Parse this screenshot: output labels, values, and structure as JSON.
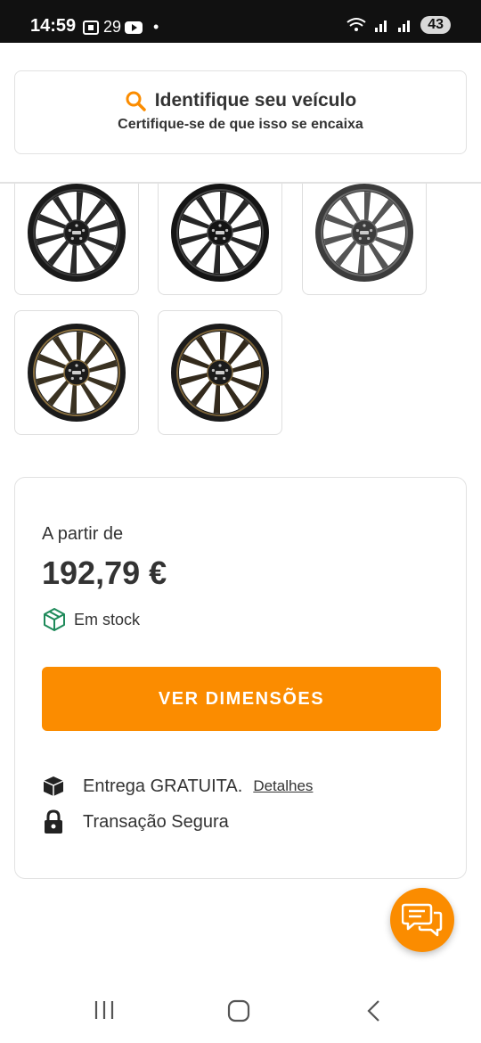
{
  "status_bar": {
    "time": "14:59",
    "temperature": "29",
    "battery": "43"
  },
  "vehicle": {
    "title": "Identifique seu veículo",
    "subtitle": "Certifique-se de que isso se encaixa"
  },
  "gallery": {
    "items": [
      {
        "icon": "wheel-matte-black",
        "rim": "#1a1a1a",
        "spoke": "#2a2a2a",
        "accent": "#3a3a3a"
      },
      {
        "icon": "wheel-gloss-black",
        "rim": "#141414",
        "spoke": "#262626",
        "accent": "#444444"
      },
      {
        "icon": "wheel-gunmetal",
        "rim": "#3c3c3c",
        "spoke": "#555555",
        "accent": "#6a6a6a"
      },
      {
        "icon": "wheel-black-bronze",
        "rim": "#1b1b1b",
        "spoke": "#3a3222",
        "accent": "#8a7040"
      },
      {
        "icon": "wheel-black-gold",
        "rim": "#1b1b1b",
        "spoke": "#332a1c",
        "accent": "#7a6238"
      }
    ]
  },
  "offer": {
    "from_label": "A partir de",
    "price": "192,79 €",
    "stock_label": "Em stock",
    "cta_label": "VER DIMENSÕES",
    "delivery_label": "Entrega GRATUITA.",
    "details_link": "Detalhes",
    "secure_label": "Transação Segura"
  },
  "colors": {
    "accent": "#fb8c00",
    "stock_icon": "#1e8a5a",
    "text": "#333333"
  }
}
